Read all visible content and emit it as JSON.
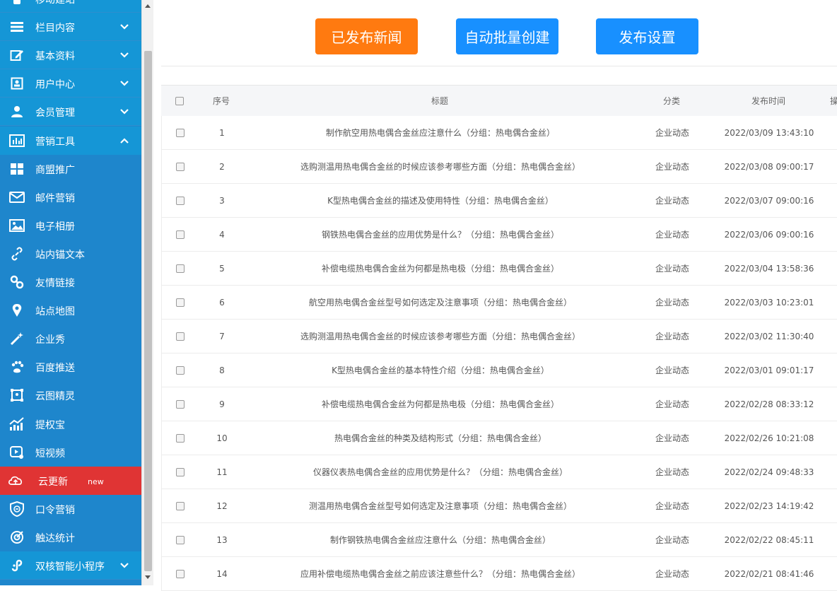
{
  "sidebar": {
    "items": [
      {
        "label": "移动建站",
        "icon": "mobile-icon",
        "kind": "top"
      },
      {
        "label": "栏目内容",
        "icon": "list-icon",
        "kind": "top",
        "chevron": "down"
      },
      {
        "label": "基本资料",
        "icon": "edit-icon",
        "kind": "top",
        "chevron": "down"
      },
      {
        "label": "用户中心",
        "icon": "user-card-icon",
        "kind": "top",
        "chevron": "down"
      },
      {
        "label": "会员管理",
        "icon": "member-icon",
        "kind": "top",
        "chevron": "down"
      },
      {
        "label": "营销工具",
        "icon": "bar-chart-icon",
        "kind": "active",
        "chevron": "up"
      },
      {
        "label": "商盟推广",
        "icon": "grid-icon",
        "kind": "sub"
      },
      {
        "label": "邮件营销",
        "icon": "mail-icon",
        "kind": "sub"
      },
      {
        "label": "电子相册",
        "icon": "image-icon",
        "kind": "sub"
      },
      {
        "label": "站内锚文本",
        "icon": "link-icon",
        "kind": "sub"
      },
      {
        "label": "友情链接",
        "icon": "chain-icon",
        "kind": "sub"
      },
      {
        "label": "站点地图",
        "icon": "map-pin-icon",
        "kind": "sub"
      },
      {
        "label": "企业秀",
        "icon": "magic-wand-icon",
        "kind": "sub"
      },
      {
        "label": "百度推送",
        "icon": "paw-icon",
        "kind": "sub"
      },
      {
        "label": "云图精灵",
        "icon": "image-frame-icon",
        "kind": "sub"
      },
      {
        "label": "提权宝",
        "icon": "trend-icon",
        "kind": "sub"
      },
      {
        "label": "短视频",
        "icon": "video-icon",
        "kind": "sub"
      },
      {
        "label": "云更新",
        "icon": "cloud-icon",
        "kind": "highlight",
        "badge": "new"
      },
      {
        "label": "口令营销",
        "icon": "shield-icon",
        "kind": "sub"
      },
      {
        "label": "触达统计",
        "icon": "target-icon",
        "kind": "sub"
      },
      {
        "label": "双核智能小程序",
        "icon": "miniapp-icon",
        "kind": "top",
        "chevron": "down"
      }
    ]
  },
  "toolbar": {
    "published_label": "已发布新闻",
    "batch_label": "自动批量创建",
    "settings_label": "发布设置"
  },
  "table": {
    "headers": {
      "no": "序号",
      "title": "标题",
      "category": "分类",
      "time": "发布时间",
      "op": "操"
    },
    "rows": [
      {
        "no": "1",
        "title": "制作航空用热电偶合金丝应注意什么（分组：热电偶合金丝）",
        "category": "企业动态",
        "time": "2022/03/09 13:43:10"
      },
      {
        "no": "2",
        "title": "选购测温用热电偶合金丝的时候应该参考哪些方面（分组：热电偶合金丝）",
        "category": "企业动态",
        "time": "2022/03/08 09:00:17"
      },
      {
        "no": "3",
        "title": "K型热电偶合金丝的描述及使用特性（分组：热电偶合金丝）",
        "category": "企业动态",
        "time": "2022/03/07 09:00:16"
      },
      {
        "no": "4",
        "title": "钢铁热电偶合金丝的应用优势是什么？（分组：热电偶合金丝）",
        "category": "企业动态",
        "time": "2022/03/06 09:00:16"
      },
      {
        "no": "5",
        "title": "补偿电缆热电偶合金丝为何都是热电极（分组：热电偶合金丝）",
        "category": "企业动态",
        "time": "2022/03/04 13:58:36"
      },
      {
        "no": "6",
        "title": "航空用热电偶合金丝型号如何选定及注意事项（分组：热电偶合金丝）",
        "category": "企业动态",
        "time": "2022/03/03 10:23:01"
      },
      {
        "no": "7",
        "title": "选购测温用热电偶合金丝的时候应该参考哪些方面（分组：热电偶合金丝）",
        "category": "企业动态",
        "time": "2022/03/02 11:30:40"
      },
      {
        "no": "8",
        "title": "K型热电偶合金丝的基本特性介绍（分组：热电偶合金丝）",
        "category": "企业动态",
        "time": "2022/03/01 09:01:17"
      },
      {
        "no": "9",
        "title": "补偿电缆热电偶合金丝为何都是热电极（分组：热电偶合金丝）",
        "category": "企业动态",
        "time": "2022/02/28 08:33:12"
      },
      {
        "no": "10",
        "title": "热电偶合金丝的种类及结构形式（分组：热电偶合金丝）",
        "category": "企业动态",
        "time": "2022/02/26 10:21:08"
      },
      {
        "no": "11",
        "title": "仪器仪表热电偶合金丝的应用优势是什么？（分组：热电偶合金丝）",
        "category": "企业动态",
        "time": "2022/02/24 09:48:33"
      },
      {
        "no": "12",
        "title": "测温用热电偶合金丝型号如何选定及注意事项（分组：热电偶合金丝）",
        "category": "企业动态",
        "time": "2022/02/23 14:19:42"
      },
      {
        "no": "13",
        "title": "制作钢铁热电偶合金丝应注意什么（分组：热电偶合金丝）",
        "category": "企业动态",
        "time": "2022/02/22 08:45:11"
      },
      {
        "no": "14",
        "title": "应用补偿电缆热电偶合金丝之前应该注意些什么？（分组：热电偶合金丝）",
        "category": "企业动态",
        "time": "2022/02/21 08:41:46"
      }
    ]
  },
  "colors": {
    "sidebar_bg": "#1e86cc",
    "sidebar_top_bg": "#1596d6",
    "highlight_bg": "#e03434",
    "orange_button": "#ff7a10",
    "blue_button": "#1890ff"
  }
}
